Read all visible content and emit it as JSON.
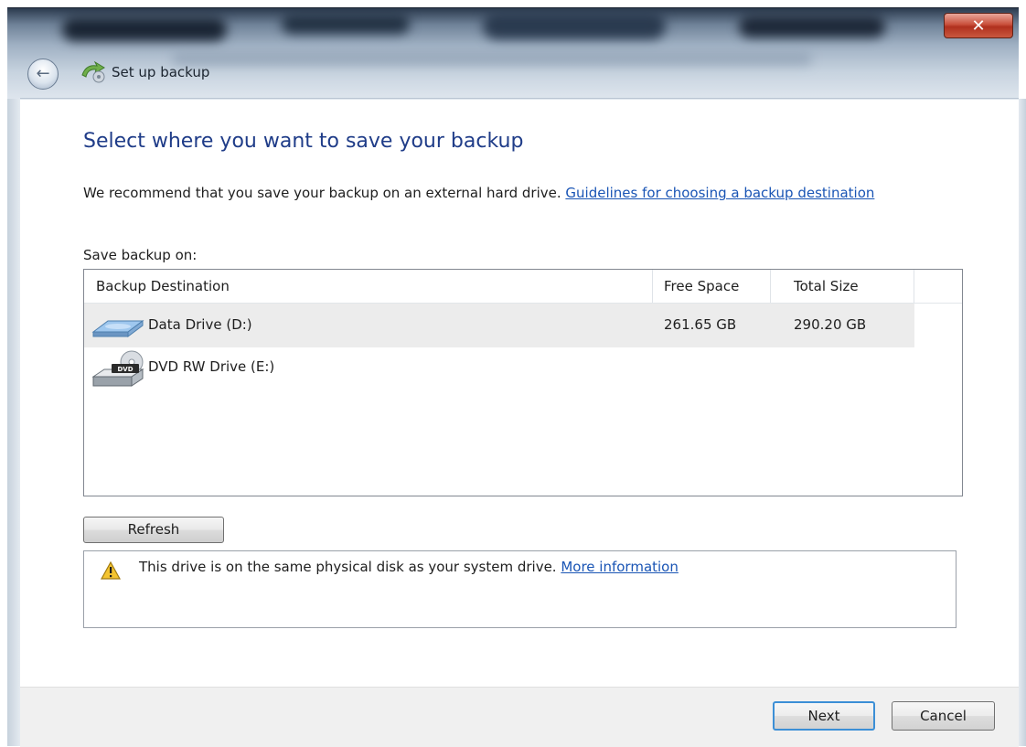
{
  "window": {
    "title": "Set up backup",
    "close_glyph": "✕",
    "back_glyph": "←",
    "icons": {
      "back": "back-arrow-icon",
      "app": "backup-icon",
      "close": "close-icon"
    }
  },
  "page": {
    "heading": "Select where you want to save your backup",
    "recommend_text": "We recommend that you save your backup on an external hard drive. ",
    "recommend_link": "Guidelines for choosing a backup destination",
    "save_on_label": "Save backup on:"
  },
  "destinations": {
    "columns": [
      "Backup Destination",
      "Free Space",
      "Total Size"
    ],
    "rows": [
      {
        "name": "Data Drive (D:)",
        "free": "261.65 GB",
        "total": "290.20 GB",
        "icon": "hard-drive-icon",
        "selected": true
      },
      {
        "name": "DVD RW Drive (E:)",
        "free": "",
        "total": "",
        "icon": "dvd-drive-icon",
        "selected": false
      }
    ]
  },
  "refresh_label": "Refresh",
  "warning": {
    "icon": "warning-icon",
    "text": "This drive is on the same physical disk as your system drive. ",
    "link": "More information"
  },
  "footer": {
    "next_label": "Next",
    "cancel_label": "Cancel"
  },
  "colors": {
    "heading": "#1f3c88",
    "link": "#1a55b5",
    "accent_focus": "#3c8fd6"
  }
}
